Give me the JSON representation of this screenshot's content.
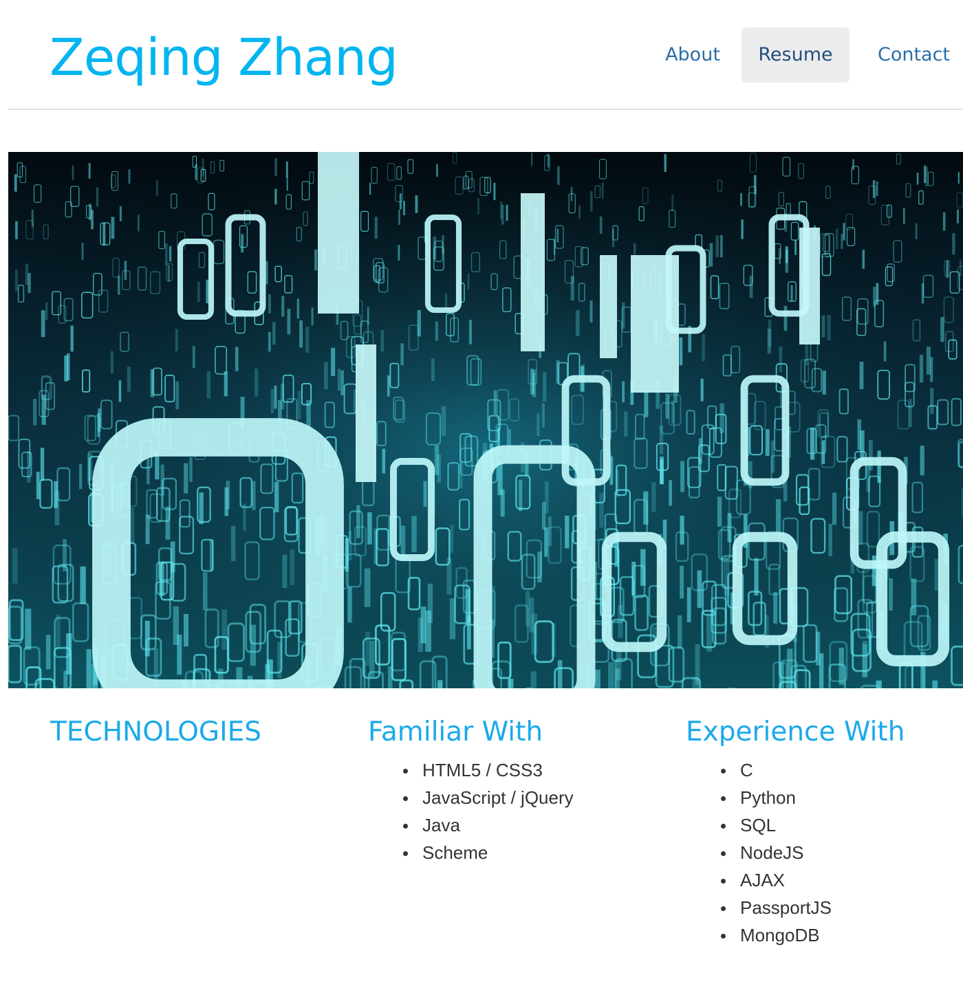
{
  "header": {
    "site_title": "Zeqing Zhang",
    "nav": [
      {
        "label": "About",
        "active": false
      },
      {
        "label": "Resume",
        "active": true
      },
      {
        "label": "Contact",
        "active": false
      }
    ]
  },
  "hero": {
    "image_description_icon": "binary-code-hero-image"
  },
  "sections": {
    "technologies": {
      "heading": "TECHNOLOGIES"
    },
    "familiar": {
      "heading": "Familiar With",
      "items": [
        "HTML5 / CSS3",
        "JavaScript / jQuery",
        "Java",
        "Scheme"
      ]
    },
    "experience": {
      "heading": "Experience With",
      "items": [
        "C",
        "Python",
        "SQL",
        "NodeJS",
        "AJAX",
        "PassportJS",
        "MongoDB"
      ]
    }
  },
  "colors": {
    "accent": "#00b5f0",
    "nav_link": "#2a6ea8",
    "nav_active_bg": "#ececec",
    "body_text": "#333333",
    "hero_glow": "#5fe6f0"
  }
}
